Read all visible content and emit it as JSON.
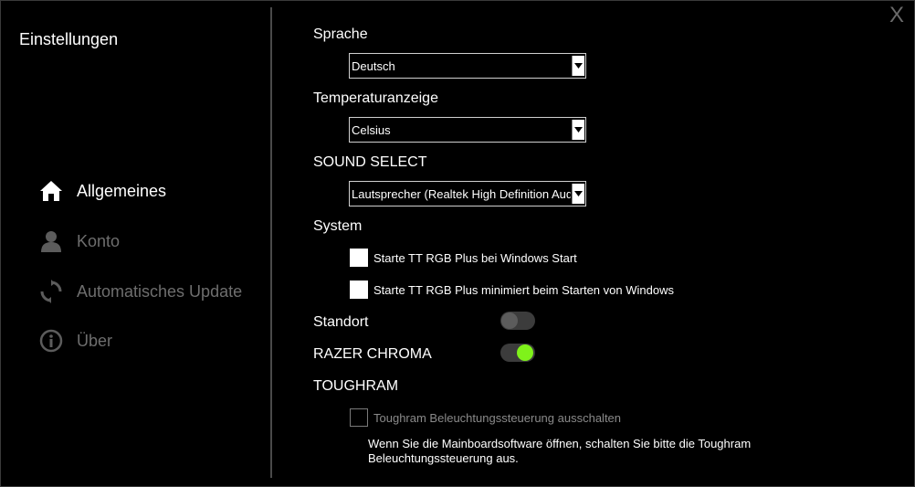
{
  "window": {
    "close_label": "X"
  },
  "sidebar": {
    "title": "Einstellungen",
    "items": [
      {
        "label": "Allgemeines",
        "icon": "home-icon",
        "active": true
      },
      {
        "label": "Konto",
        "icon": "user-icon",
        "active": false
      },
      {
        "label": "Automatisches Update",
        "icon": "refresh-icon",
        "active": false
      },
      {
        "label": "Über",
        "icon": "info-icon",
        "active": false
      }
    ]
  },
  "language": {
    "label": "Sprache",
    "value": "Deutsch"
  },
  "temperature": {
    "label": "Temperaturanzeige",
    "value": "Celsius"
  },
  "sound": {
    "label": "SOUND SELECT",
    "value": "Lautsprecher (Realtek High Definition Audio)"
  },
  "system": {
    "label": "System",
    "options": [
      {
        "label": "Starte TT RGB Plus bei Windows Start",
        "checked": false
      },
      {
        "label": "Starte TT RGB Plus minimiert beim Starten von Windows",
        "checked": false
      }
    ]
  },
  "location": {
    "label": "Standort",
    "enabled": false
  },
  "razer_chroma": {
    "label": "RAZER CHROMA",
    "enabled": true
  },
  "toughram": {
    "label": "TOUGHRAM",
    "option_label": "Toughram Beleuchtungssteuerung ausschalten",
    "option_checked": false,
    "note": "Wenn Sie die Mainboardsoftware öffnen, schalten Sie bitte die Toughram Beleuchtungssteuerung aus."
  },
  "colors": {
    "accent": "#7ff21a",
    "background": "#000000",
    "inactive_text": "#6e6e6e"
  }
}
